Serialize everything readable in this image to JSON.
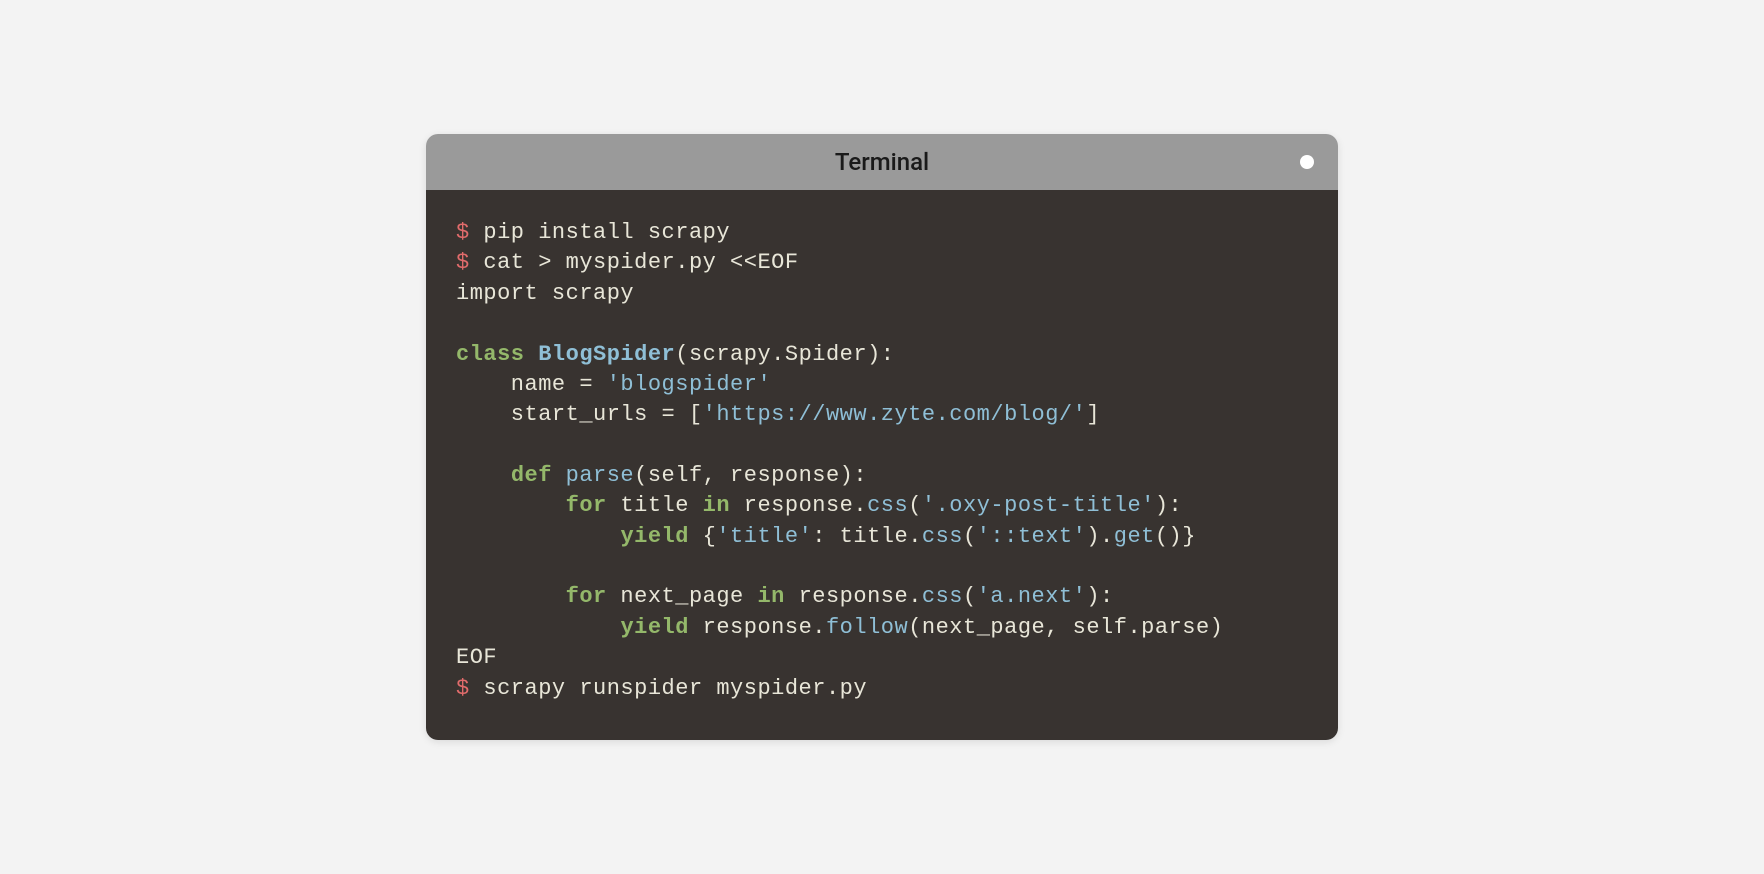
{
  "window": {
    "title": "Terminal"
  },
  "code": {
    "prompt": "$",
    "line1_cmd": "pip install scrapy",
    "line2_cmd": "cat > myspider.py <<EOF",
    "line3": "import scrapy",
    "line4_kw": "class",
    "line4_name": "BlogSpider",
    "line4_rest": "(scrapy.Spider):",
    "line5_a": "    name = ",
    "line5_str": "'blogspider'",
    "line6_a": "    start_urls = [",
    "line6_str": "'https://www.zyte.com/blog/'",
    "line6_b": "]",
    "line7_kw": "def",
    "line7_fn": "parse",
    "line7_rest": "(self, response):",
    "line8_kw": "for",
    "line8_a": " title ",
    "line8_kw2": "in",
    "line8_b": " response.",
    "line8_fn": "css",
    "line8_c": "(",
    "line8_str": "'.oxy-post-title'",
    "line8_d": "):",
    "line9_kw": "yield",
    "line9_a": " {",
    "line9_str1": "'title'",
    "line9_b": ": title.",
    "line9_fn": "css",
    "line9_c": "(",
    "line9_str2": "'::text'",
    "line9_d": ").",
    "line9_fn2": "get",
    "line9_e": "()}",
    "line10_kw": "for",
    "line10_a": " next_page ",
    "line10_kw2": "in",
    "line10_b": " response.",
    "line10_fn": "css",
    "line10_c": "(",
    "line10_str": "'a.next'",
    "line10_d": "):",
    "line11_kw": "yield",
    "line11_a": " response.",
    "line11_fn": "follow",
    "line11_b": "(next_page, self.parse)",
    "line12": "EOF",
    "line13_cmd": "scrapy runspider myspider.py"
  }
}
